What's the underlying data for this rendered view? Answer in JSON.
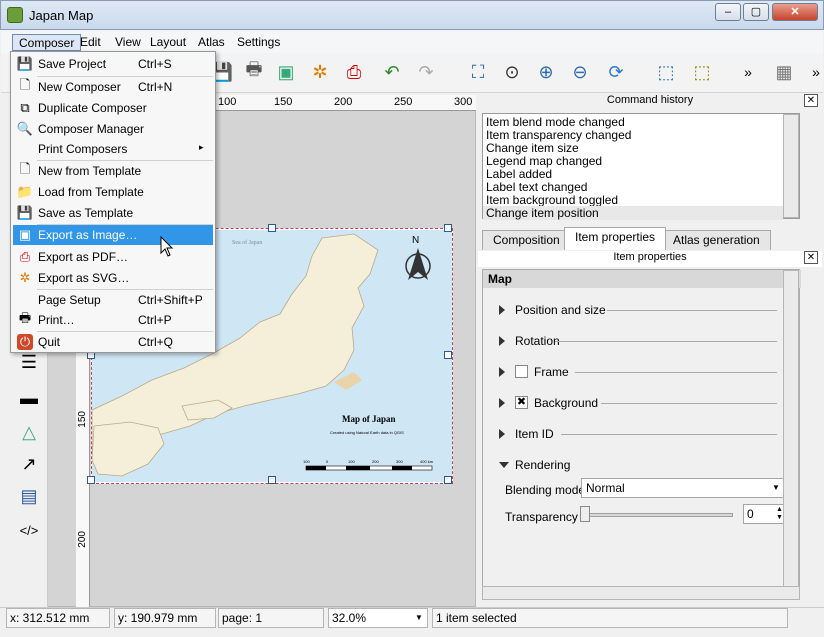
{
  "window": {
    "title": "Japan Map"
  },
  "menubar": [
    "Composer",
    "Edit",
    "View",
    "Layout",
    "Atlas",
    "Settings"
  ],
  "composer_menu": {
    "save_project": {
      "label": "Save Project",
      "shortcut": "Ctrl+S"
    },
    "new_composer": {
      "label": "New Composer",
      "shortcut": "Ctrl+N"
    },
    "duplicate_composer": {
      "label": "Duplicate Composer"
    },
    "composer_manager": {
      "label": "Composer Manager"
    },
    "print_composers": {
      "label": "Print Composers"
    },
    "new_from_template": {
      "label": "New from Template"
    },
    "load_from_template": {
      "label": "Load from Template"
    },
    "save_as_template": {
      "label": "Save as Template"
    },
    "export_image": {
      "label": "Export as Image…"
    },
    "export_pdf": {
      "label": "Export as PDF…"
    },
    "export_svg": {
      "label": "Export as SVG…"
    },
    "page_setup": {
      "label": "Page Setup",
      "shortcut": "Ctrl+Shift+P"
    },
    "print": {
      "label": "Print…",
      "shortcut": "Ctrl+P"
    },
    "quit": {
      "label": "Quit",
      "shortcut": "Ctrl+Q"
    }
  },
  "ruler": {
    "ticks": [
      "100",
      "150",
      "200",
      "250",
      "300"
    ]
  },
  "map": {
    "title": "Map of Japan",
    "subtitle": "Created using Natural Earth data in QGIS",
    "north": "N",
    "sea_label": "Sea of Japan",
    "scale_ticks": [
      "100",
      "0",
      "100",
      "200",
      "300",
      "400 km"
    ]
  },
  "command_history": {
    "title": "Command history",
    "items": [
      "Item blend mode changed",
      "Item transparency changed",
      "Change item size",
      "Legend map changed",
      "Label added",
      "Label text changed",
      "Item background toggled",
      "Change item position"
    ]
  },
  "tabs": [
    "Composition",
    "Item properties",
    "Atlas generation"
  ],
  "item_properties": {
    "title": "Item properties",
    "header": "Map",
    "groups": [
      "Position and size",
      "Rotation",
      "Frame",
      "Background",
      "Item ID",
      "Rendering"
    ],
    "blending_label": "Blending mode",
    "blending_value": "Normal",
    "transparency_label": "Transparency",
    "transparency_value": "0"
  },
  "status": {
    "x": "x: 312.512 mm",
    "y": "y: 190.979 mm",
    "page": "page: 1",
    "zoom": "32.0%",
    "selection": "1 item selected"
  }
}
